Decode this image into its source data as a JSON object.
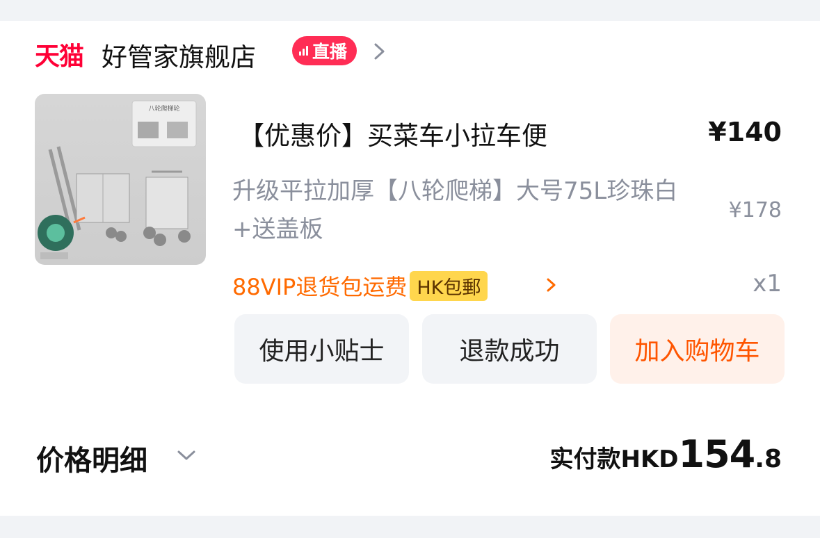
{
  "store": {
    "brand": "天猫",
    "name": "好管家旗舰店",
    "live_label": "直播"
  },
  "product": {
    "image_alt": "八轮爬梯轮 大号 买菜车",
    "image_caption": "八轮爬梯轮",
    "title": "【优惠价】买菜车小拉车便",
    "price": "¥140",
    "spec": "升级平拉加厚【八轮爬梯】大号75L珍珠白+送盖板",
    "original_price": "¥178",
    "vip_text": "88VIP退货包运费",
    "shipping_tag": "HK包郵",
    "quantity": "x1"
  },
  "actions": {
    "tips": "使用小贴士",
    "refund": "退款成功",
    "add_cart": "加入购物车"
  },
  "summary": {
    "price_detail": "价格明细",
    "paid_label": "实付款",
    "currency": "HKD",
    "amount_int": "154",
    "amount_dec": ".8"
  },
  "colors": {
    "brand_red": "#ff0036",
    "live_badge": "#ff2d55",
    "orange": "#ff6a00",
    "tag_yellow": "#ffd64d",
    "muted_text": "#8a8f9c"
  }
}
